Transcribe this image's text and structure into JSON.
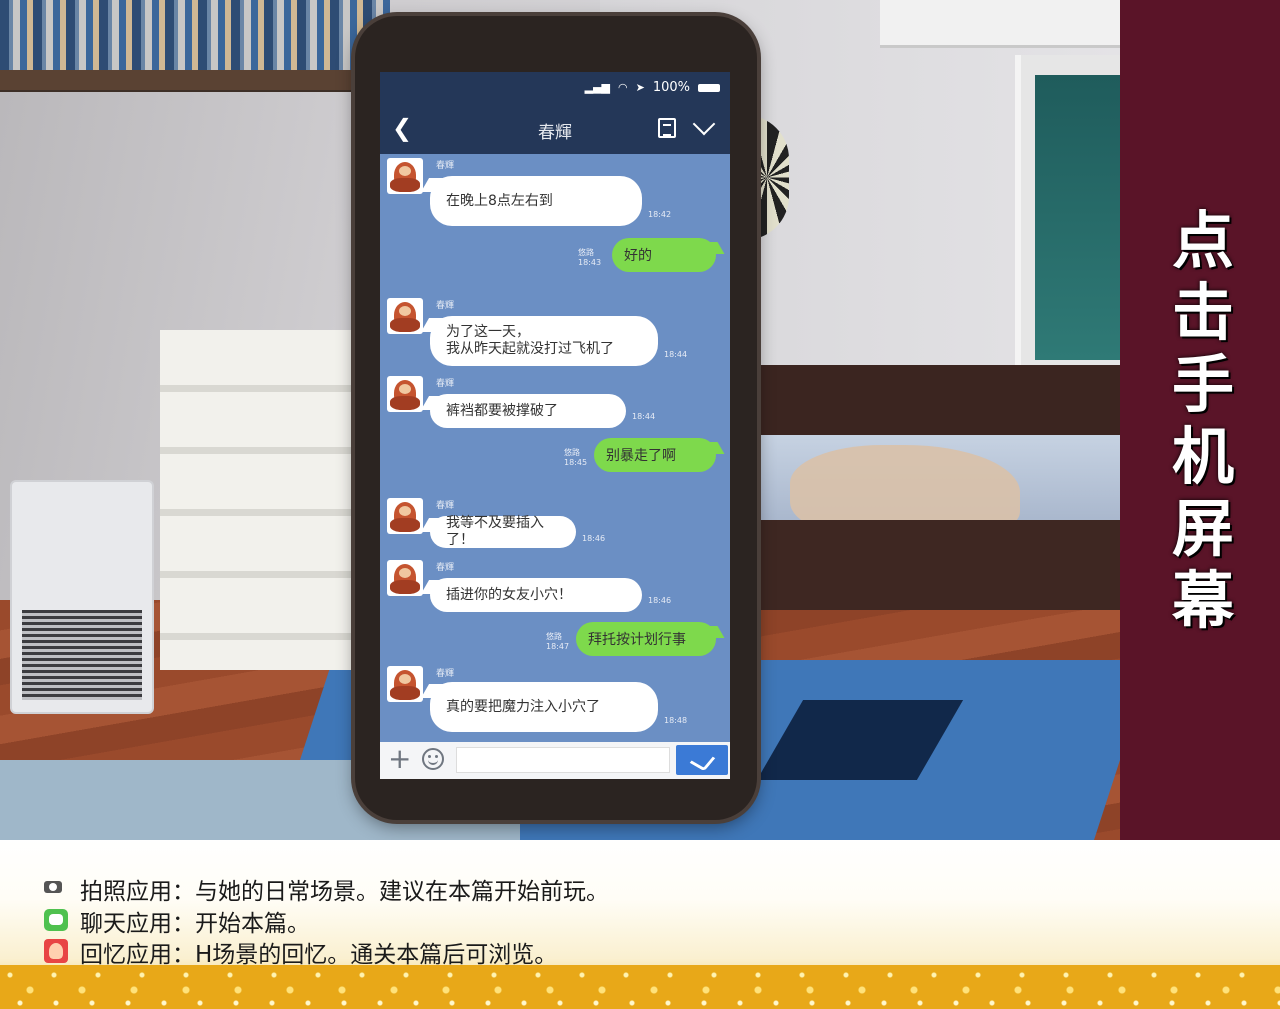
{
  "banner": {
    "text": "点击手机屏幕"
  },
  "phone": {
    "status": {
      "battery": "100%"
    },
    "header": {
      "title": "春輝"
    },
    "messages": [
      {
        "side": "in",
        "sender": "春輝",
        "text": "在晚上8点左右到",
        "time": "18:42"
      },
      {
        "side": "out",
        "sender": "悠路",
        "text": "好的",
        "time": "18:43"
      },
      {
        "side": "in",
        "sender": "春輝",
        "line1": "为了这一天，",
        "line2": "我从昨天起就没打过飞机了",
        "time": "18:44"
      },
      {
        "side": "in",
        "sender": "春輝",
        "text": "裤裆都要被撑破了",
        "time": "18:44"
      },
      {
        "side": "out",
        "sender": "悠路",
        "text": "别暴走了啊",
        "time": "18:45"
      },
      {
        "side": "in",
        "sender": "春輝",
        "text": "我等不及要插入了！",
        "time": "18:46"
      },
      {
        "side": "in",
        "sender": "春輝",
        "text": "插进你的女友小穴！",
        "time": "18:46"
      },
      {
        "side": "out",
        "sender": "悠路",
        "text": "拜托按计划行事",
        "time": "18:47"
      },
      {
        "side": "in",
        "sender": "春輝",
        "text": "真的要把魔力注入小穴了",
        "time": "18:48"
      }
    ],
    "input": {
      "placeholder": ""
    }
  },
  "info": {
    "camera": "拍照应用：与她的日常场景。建议在本篇开始前玩。",
    "chat": "聊天应用：开始本篇。",
    "memory": "回忆应用：H场景的回忆。通关本篇后可浏览。"
  },
  "colors": {
    "banner": "#5a1428",
    "header": "#243758",
    "chat_bg": "#6b8fc4",
    "out_bubble": "#7ed94c",
    "send": "#3b7ad6"
  }
}
